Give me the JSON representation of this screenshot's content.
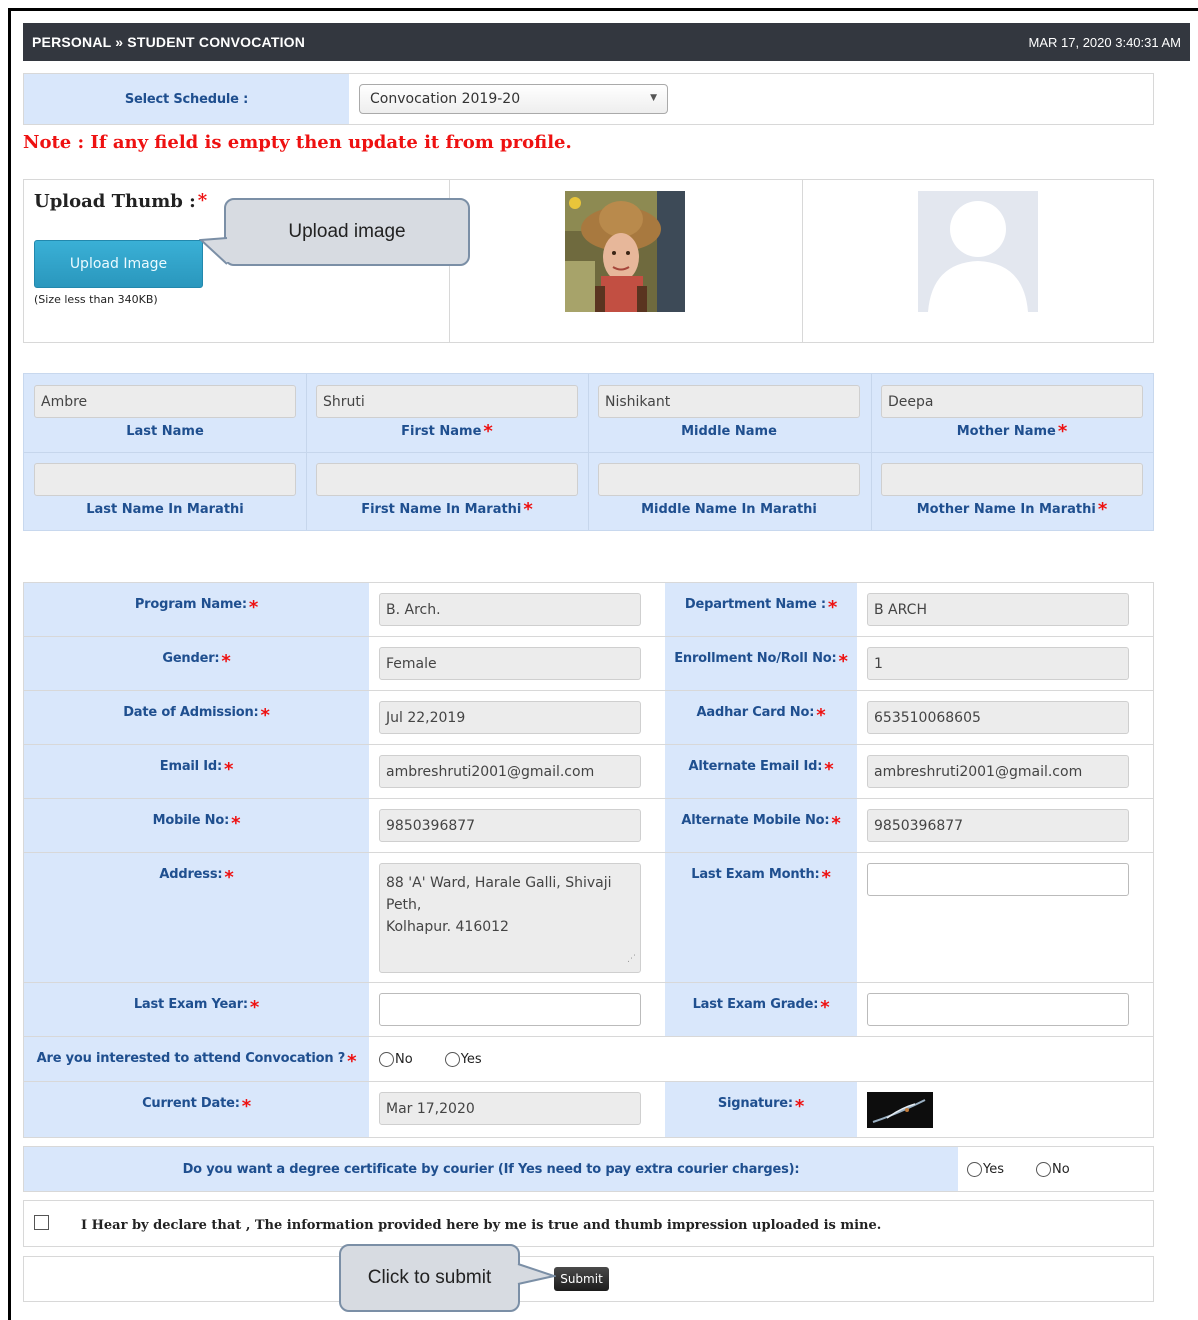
{
  "header": {
    "title": "PERSONAL » STUDENT CONVOCATION",
    "timestamp": "MAR 17, 2020  3:40:31 AM"
  },
  "schedule": {
    "label": "Select Schedule :",
    "selected": "Convocation 2019-20"
  },
  "note": "Note : If any field is empty then update it from profile.",
  "upload": {
    "label": "Upload Thumb :",
    "button": "Upload Image",
    "size_hint": "(Size less than 340KB)"
  },
  "callouts": {
    "upload": "Upload image",
    "submit": "Click to submit"
  },
  "names": [
    {
      "value": "Ambre",
      "label": "Last Name",
      "required": false
    },
    {
      "value": "Shruti",
      "label": "First Name",
      "required": true
    },
    {
      "value": "Nishikant",
      "label": "Middle Name",
      "required": false
    },
    {
      "value": "Deepa",
      "label": "Mother Name",
      "required": true
    },
    {
      "value": "",
      "label": "Last Name In Marathi",
      "required": false
    },
    {
      "value": "",
      "label": "First Name In Marathi",
      "required": true
    },
    {
      "value": "",
      "label": "Middle Name In Marathi",
      "required": false
    },
    {
      "value": "",
      "label": "Mother Name In Marathi",
      "required": true
    }
  ],
  "details": {
    "program_label": "Program Name:",
    "program_value": "B. Arch.",
    "department_label": "Department Name :",
    "department_value": "B ARCH",
    "gender_label": "Gender:",
    "gender_value": "Female",
    "enrollment_label": "Enrollment No/Roll No:",
    "enrollment_value": "1",
    "admission_label": "Date of Admission:",
    "admission_value": "Jul 22,2019",
    "aadhar_label": "Aadhar Card No:",
    "aadhar_value": "653510068605",
    "email_label": "Email Id:",
    "email_value": "ambreshruti2001@gmail.com",
    "alt_email_label": "Alternate Email Id:",
    "alt_email_value": "ambreshruti2001@gmail.com",
    "mobile_label": "Mobile No:",
    "mobile_value": "9850396877",
    "alt_mobile_label": "Alternate Mobile No:",
    "alt_mobile_value": "9850396877",
    "address_label": "Address:",
    "address_line1": "88 'A' Ward, Harale Galli, Shivaji Peth,",
    "address_line2": "Kolhapur. 416012",
    "exam_month_label": "Last Exam Month:",
    "exam_month_value": "",
    "exam_year_label": "Last Exam Year:",
    "exam_year_value": "",
    "exam_grade_label": "Last Exam Grade:",
    "exam_grade_value": "",
    "attend_label": "Are you interested to attend Convocation ?",
    "attend_no": "No",
    "attend_yes": "Yes",
    "current_date_label": "Current Date:",
    "current_date_value": "Mar 17,2020",
    "signature_label": "Signature:"
  },
  "courier": {
    "label": "Do you want a degree certificate by courier (If Yes need to pay extra courier charges):",
    "yes": "Yes",
    "no": "No"
  },
  "declaration": "I Hear by declare that , The information provided here by me is true and thumb impression uploaded is mine.",
  "submit": "Submit"
}
